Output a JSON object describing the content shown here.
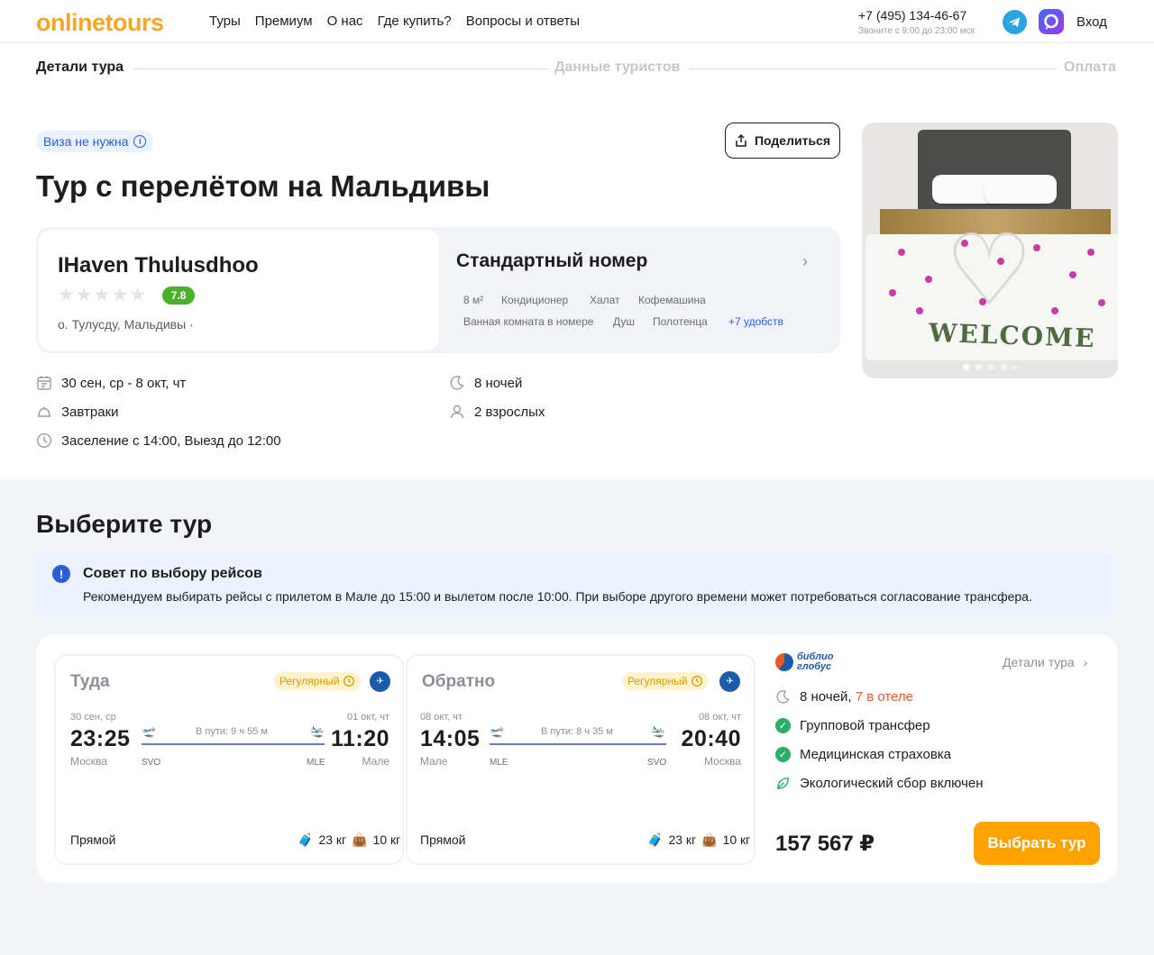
{
  "header": {
    "logo": "onlinetours",
    "nav": [
      "Туры",
      "Премиум",
      "О нас",
      "Где купить?",
      "Вопросы и ответы"
    ],
    "phone": "+7 (495) 134-46-67",
    "phone_hours": "Звоните с 9:00 до 23:00 мск",
    "login": "Вход"
  },
  "steps": [
    "Детали тура",
    "Данные туристов",
    "Оплата"
  ],
  "tour": {
    "visa": "Виза не нужна",
    "share": "Поделиться",
    "title": "Тур с перелётом на Мальдивы",
    "hotel": {
      "name": "IHaven Thulusdhoo",
      "stars": 0,
      "rating": "7.8",
      "location": "о. Тулусду, Мальдивы ·"
    },
    "room": {
      "name": "Стандартный номер",
      "amenities_row1": [
        "8 м²",
        "Кондиционер",
        "Халат",
        "Кофемашина"
      ],
      "amenities_row2": [
        "Ванная комната в номере",
        "Душ",
        "Полотенца"
      ],
      "more": "+7 удобств"
    },
    "photo": {
      "caption": "WELCOME",
      "slides": 5,
      "active_slide": 1
    },
    "details": {
      "dates": "30 сен, ср - 8 окт, чт",
      "meal": "Завтраки",
      "checkin": "Заселение с 14:00, Выезд до 12:00",
      "nights": "8 ночей",
      "guests": "2 взрослых"
    }
  },
  "choose": {
    "title": "Выберите тур",
    "tip_title": "Совет по выбору рейсов",
    "tip_text": "Рекомендуем выбирать рейсы с прилетом в Мале до 15:00 и вылетом после 10:00. При выборе другого времени может потребоваться согласование трансфера."
  },
  "offer": {
    "outbound": {
      "direction": "Туда",
      "badge": "Регулярный",
      "dep_date": "30 сен, ср",
      "dep_time": "23:25",
      "dep_city": "Москва",
      "dep_code": "SVO",
      "arr_date": "01 окт, чт",
      "arr_time": "11:20",
      "arr_city": "Мале",
      "arr_code": "MLE",
      "duration": "В пути: 9 ч 55 м",
      "type": "Прямой",
      "bag_checked": "23 кг",
      "bag_cabin": "10 кг"
    },
    "return": {
      "direction": "Обратно",
      "badge": "Регулярный",
      "dep_date": "08 окт, чт",
      "dep_time": "14:05",
      "dep_city": "Мале",
      "dep_code": "MLE",
      "arr_date": "08 окт, чт",
      "arr_time": "20:40",
      "arr_city": "Москва",
      "arr_code": "SVO",
      "duration": "В пути: 8 ч 35 м",
      "type": "Прямой",
      "bag_checked": "23 кг",
      "bag_cabin": "10 кг"
    },
    "operator_line1": "библио",
    "operator_line2": "глобус",
    "tour_details": "Детали тура",
    "nights": "8 ночей,",
    "hotel_nights": "7 в отеле",
    "services": [
      "Групповой трансфер",
      "Медицинская страховка",
      "Экологический сбор включен"
    ],
    "price": "157 567 ₽",
    "choose_button": "Выбрать тур"
  },
  "colors": {
    "brand": "#f5a623",
    "accent_button": "#ffa200",
    "link": "#2b5fd9",
    "rating": "#4caf2c",
    "check": "#2bae66"
  }
}
